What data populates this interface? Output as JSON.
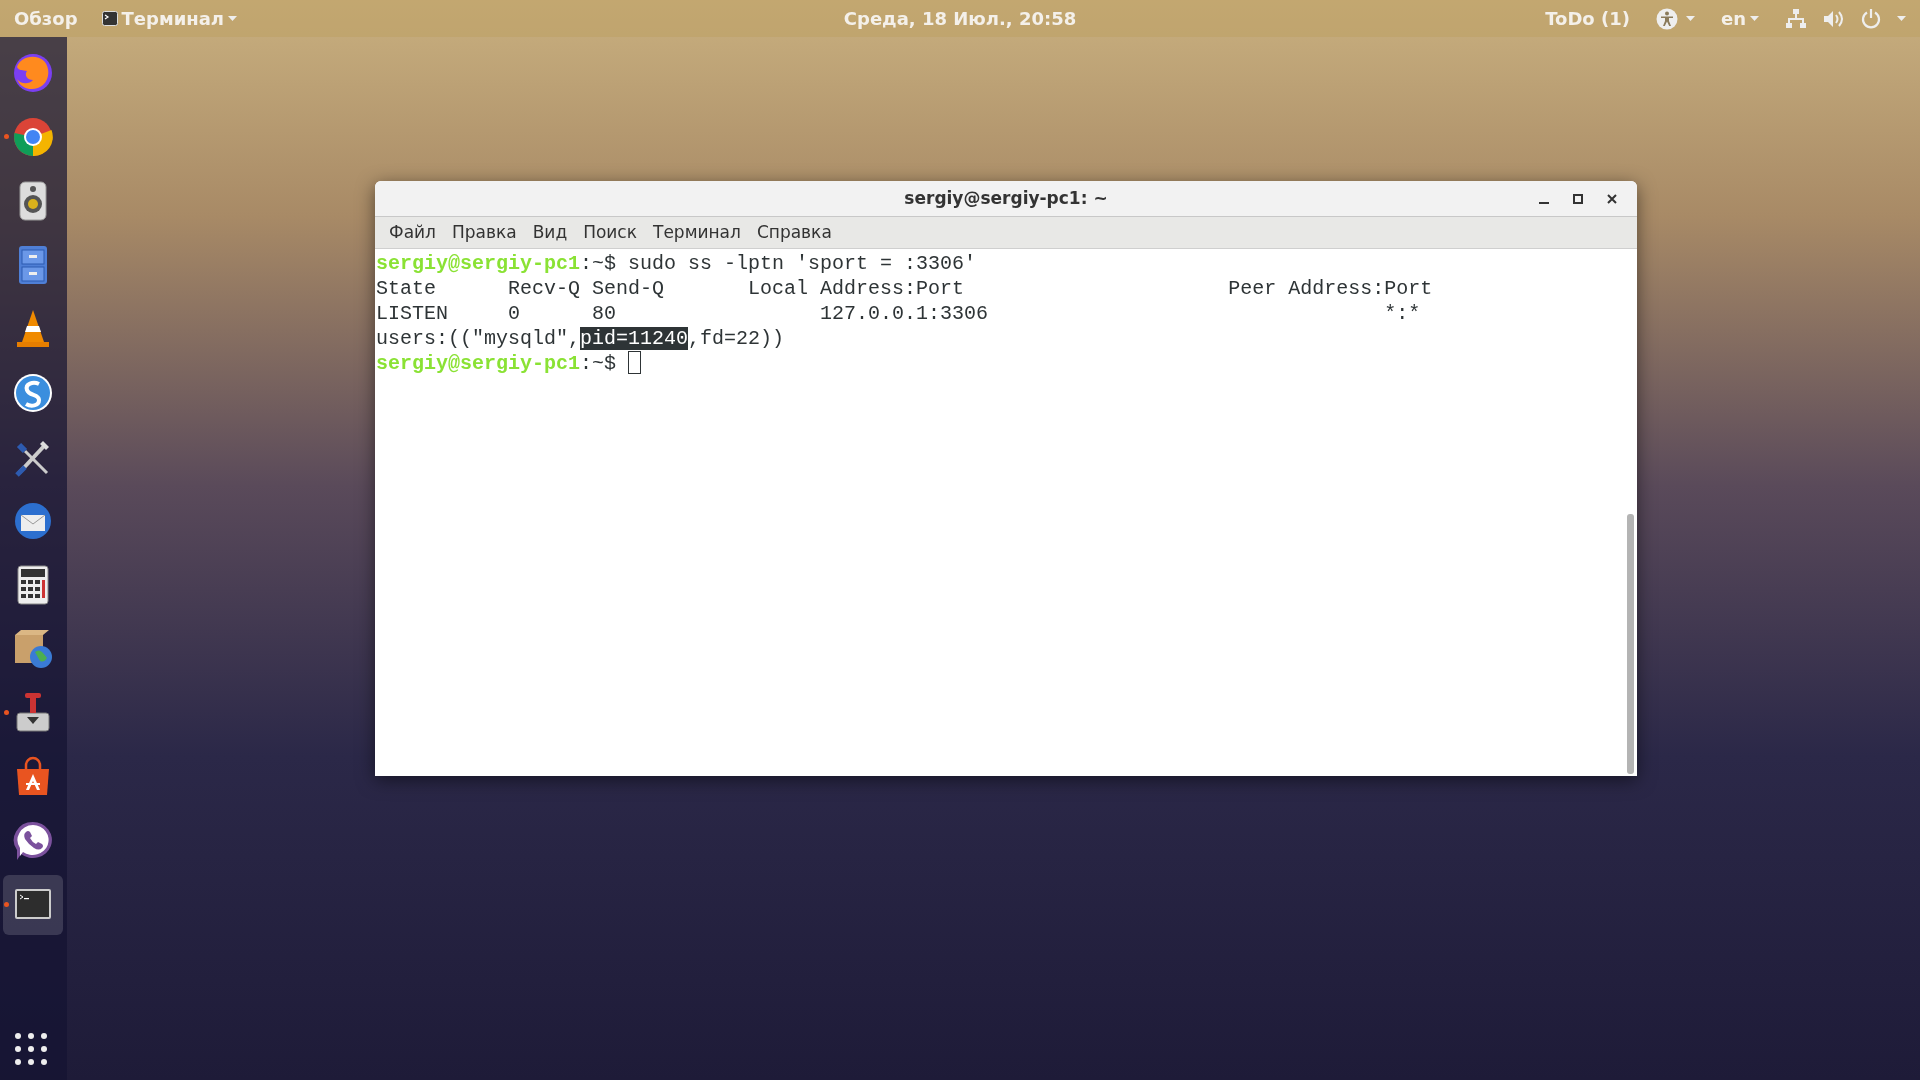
{
  "top_bar": {
    "overview": "Обзор",
    "app_menu": "Терминал",
    "clock": "Среда, 18 Июл., 20:58",
    "todo": "ToDo (1)",
    "language": "en"
  },
  "dock": {
    "items": [
      {
        "running": false,
        "selected": false
      },
      {
        "running": true,
        "selected": false
      },
      {
        "running": false,
        "selected": false
      },
      {
        "running": false,
        "selected": false
      },
      {
        "running": false,
        "selected": false
      },
      {
        "running": false,
        "selected": false
      },
      {
        "running": false,
        "selected": false
      },
      {
        "running": false,
        "selected": false
      },
      {
        "running": false,
        "selected": false
      },
      {
        "running": false,
        "selected": false
      },
      {
        "running": true,
        "selected": false
      },
      {
        "running": false,
        "selected": false
      },
      {
        "running": false,
        "selected": false
      },
      {
        "running": true,
        "selected": true
      }
    ]
  },
  "window": {
    "title": "sergiy@sergiy-pc1: ~",
    "menu": [
      "Файл",
      "Правка",
      "Вид",
      "Поиск",
      "Терминал",
      "Справка"
    ],
    "lines": [
      {
        "kind": "prompt",
        "prompt": "sergiy@sergiy-pc1",
        "path": ":~$",
        "command": " sudo ss -lptn 'sport = :3306'"
      },
      {
        "kind": "output",
        "parts": [
          {
            "text": "State      Recv-Q Send-Q       Local Address:Port                      Peer Address:Port",
            "selected": false
          }
        ]
      },
      {
        "kind": "output",
        "parts": [
          {
            "text": "LISTEN     0      80                 127.0.0.1:3306                                 *:*",
            "selected": false
          }
        ]
      },
      {
        "kind": "output",
        "parts": [
          {
            "text": "users:((\"mysqld\",",
            "selected": false
          },
          {
            "text": "pid=11240",
            "selected": true
          },
          {
            "text": ",fd=22))",
            "selected": false
          }
        ]
      },
      {
        "kind": "input",
        "prompt": "sergiy@sergiy-pc1",
        "path": ":~$"
      }
    ]
  }
}
